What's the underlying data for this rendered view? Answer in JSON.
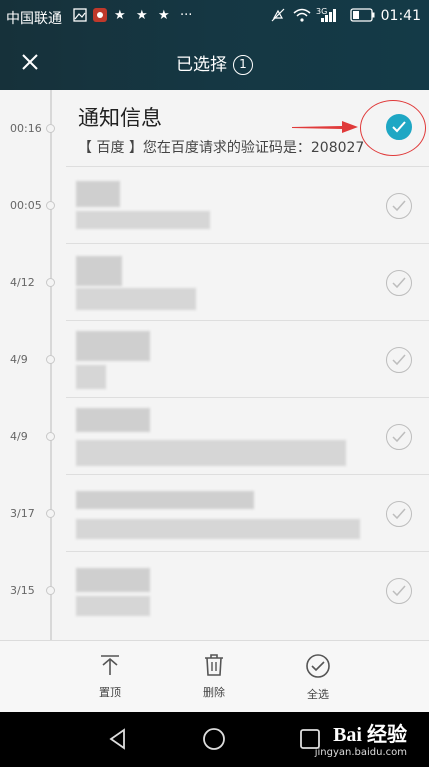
{
  "status_bar": {
    "carrier": "中国联通",
    "extra_dots": "···",
    "network": "3G",
    "time": "01:41"
  },
  "title_bar": {
    "title": "已选择",
    "selected_count": "1"
  },
  "messages": [
    {
      "time": "00:16",
      "title": "通知信息",
      "preview": "【 百度 】您在百度请求的验证码是：208027",
      "selected": true
    },
    {
      "time": "00:05",
      "title": "",
      "preview": "",
      "selected": false
    },
    {
      "time": "4/12",
      "title": "",
      "preview": "",
      "selected": false
    },
    {
      "time": "4/9",
      "title": "",
      "preview": "",
      "selected": false
    },
    {
      "time": "4/9",
      "title": "",
      "preview": "",
      "selected": false
    },
    {
      "time": "3/17",
      "title": "",
      "preview": "",
      "selected": false
    },
    {
      "time": "3/15",
      "title": "",
      "preview": "",
      "selected": false
    }
  ],
  "toolbar": {
    "pin_label": "置顶",
    "delete_label": "删除",
    "select_all_label": "全选"
  },
  "watermark": {
    "brand": "Bai 经验",
    "url": "jingyan.baidu.com"
  },
  "colors": {
    "header_bg": "#153743",
    "accent": "#1ea7c4",
    "annotation_red": "#e03a3a"
  }
}
